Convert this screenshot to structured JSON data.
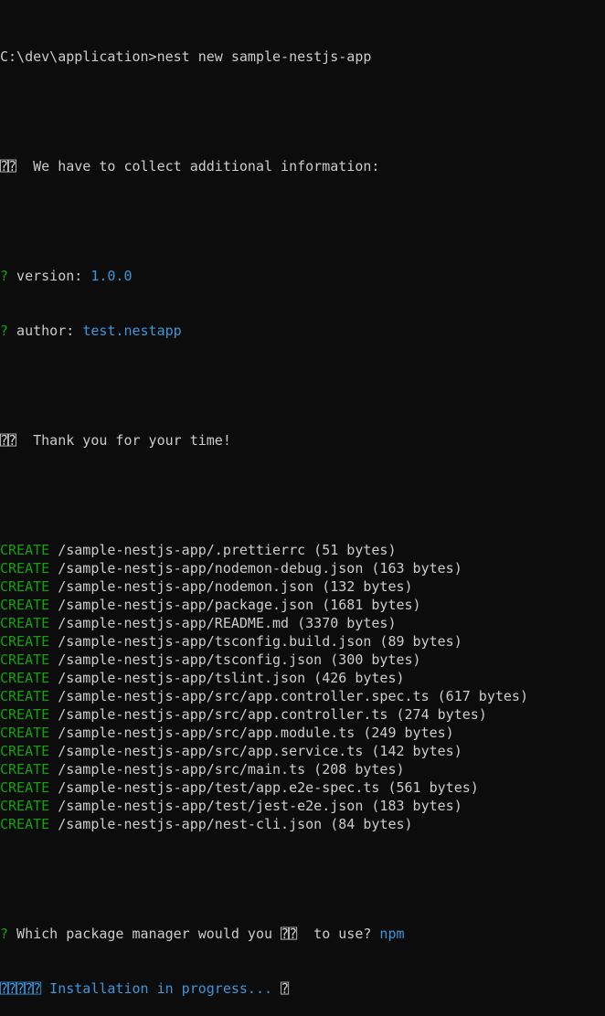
{
  "colors": {
    "background": "#0c0c0c",
    "foreground": "#cccccc",
    "create_green": "#13a10e",
    "prompt_green": "#13a10e",
    "answer_cyan": "#3a96dd"
  },
  "command": {
    "prompt": "C:\\dev\\application>",
    "text": "nest new sample-nestjs-app"
  },
  "info_line": {
    "glyph": "⍰⍰",
    "text": "  We have to collect additional information:"
  },
  "questions": [
    {
      "mark": "?",
      "label": " version: ",
      "answer": "1.0.0"
    },
    {
      "mark": "?",
      "label": " author: ",
      "answer": "test.nestapp"
    }
  ],
  "thanks_line": {
    "glyph": "⍰⍰",
    "text": "  Thank you for your time!"
  },
  "created_files": [
    {
      "action": "CREATE",
      "path": " /sample-nestjs-app/.prettierrc (51 bytes)"
    },
    {
      "action": "CREATE",
      "path": " /sample-nestjs-app/nodemon-debug.json (163 bytes)"
    },
    {
      "action": "CREATE",
      "path": " /sample-nestjs-app/nodemon.json (132 bytes)"
    },
    {
      "action": "CREATE",
      "path": " /sample-nestjs-app/package.json (1681 bytes)"
    },
    {
      "action": "CREATE",
      "path": " /sample-nestjs-app/README.md (3370 bytes)"
    },
    {
      "action": "CREATE",
      "path": " /sample-nestjs-app/tsconfig.build.json (89 bytes)"
    },
    {
      "action": "CREATE",
      "path": " /sample-nestjs-app/tsconfig.json (300 bytes)"
    },
    {
      "action": "CREATE",
      "path": " /sample-nestjs-app/tslint.json (426 bytes)"
    },
    {
      "action": "CREATE",
      "path": " /sample-nestjs-app/src/app.controller.spec.ts (617 bytes)"
    },
    {
      "action": "CREATE",
      "path": " /sample-nestjs-app/src/app.controller.ts (274 bytes)"
    },
    {
      "action": "CREATE",
      "path": " /sample-nestjs-app/src/app.module.ts (249 bytes)"
    },
    {
      "action": "CREATE",
      "path": " /sample-nestjs-app/src/app.service.ts (142 bytes)"
    },
    {
      "action": "CREATE",
      "path": " /sample-nestjs-app/src/main.ts (208 bytes)"
    },
    {
      "action": "CREATE",
      "path": " /sample-nestjs-app/test/app.e2e-spec.ts (561 bytes)"
    },
    {
      "action": "CREATE",
      "path": " /sample-nestjs-app/test/jest-e2e.json (183 bytes)"
    },
    {
      "action": "CREATE",
      "path": " /sample-nestjs-app/nest-cli.json (84 bytes)"
    }
  ],
  "package_question": {
    "mark": "?",
    "text_before": " Which package manager would you ",
    "glyph": "⍰⍰",
    "text_after": "  to use? ",
    "answer": "npm"
  },
  "progress_line": {
    "glyph": "⍰⍰⍰⍰⍰",
    "text": " Installation in progress... ",
    "spinner": "⍰"
  }
}
